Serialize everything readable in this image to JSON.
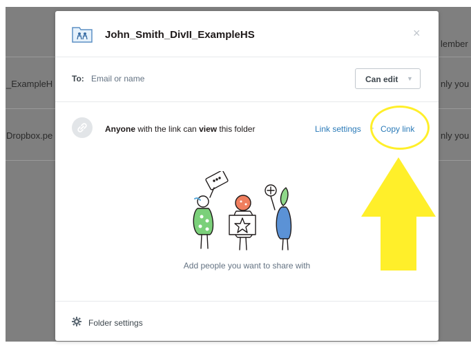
{
  "background": {
    "col_header": "lember",
    "row1_name": "_ExampleH",
    "row1_access": "nly you",
    "row2_name": "Dropbox.pe",
    "row2_access": "nly you"
  },
  "modal": {
    "title": "John_Smith_DivII_ExampleHS",
    "close_glyph": "×",
    "to_label": "To:",
    "to_placeholder": "Email or name",
    "permission": "Can edit",
    "link_text": {
      "anyone": "Anyone",
      "mid": " with the link can ",
      "view": "view",
      "end": " this folder"
    },
    "link_settings": "Link settings",
    "separator": "·",
    "copy_link": "Copy link",
    "empty_message": "Add people you want to share with",
    "folder_settings": "Folder settings"
  },
  "colors": {
    "overlay": "#7f7f7f",
    "link": "#2a7ab8",
    "annotation": "#ffef2a"
  },
  "icons": {
    "header": "shared-folder-icon",
    "close": "close-icon",
    "link": "link-icon",
    "footer": "gear-icon",
    "caret": "chevron-down-icon"
  }
}
